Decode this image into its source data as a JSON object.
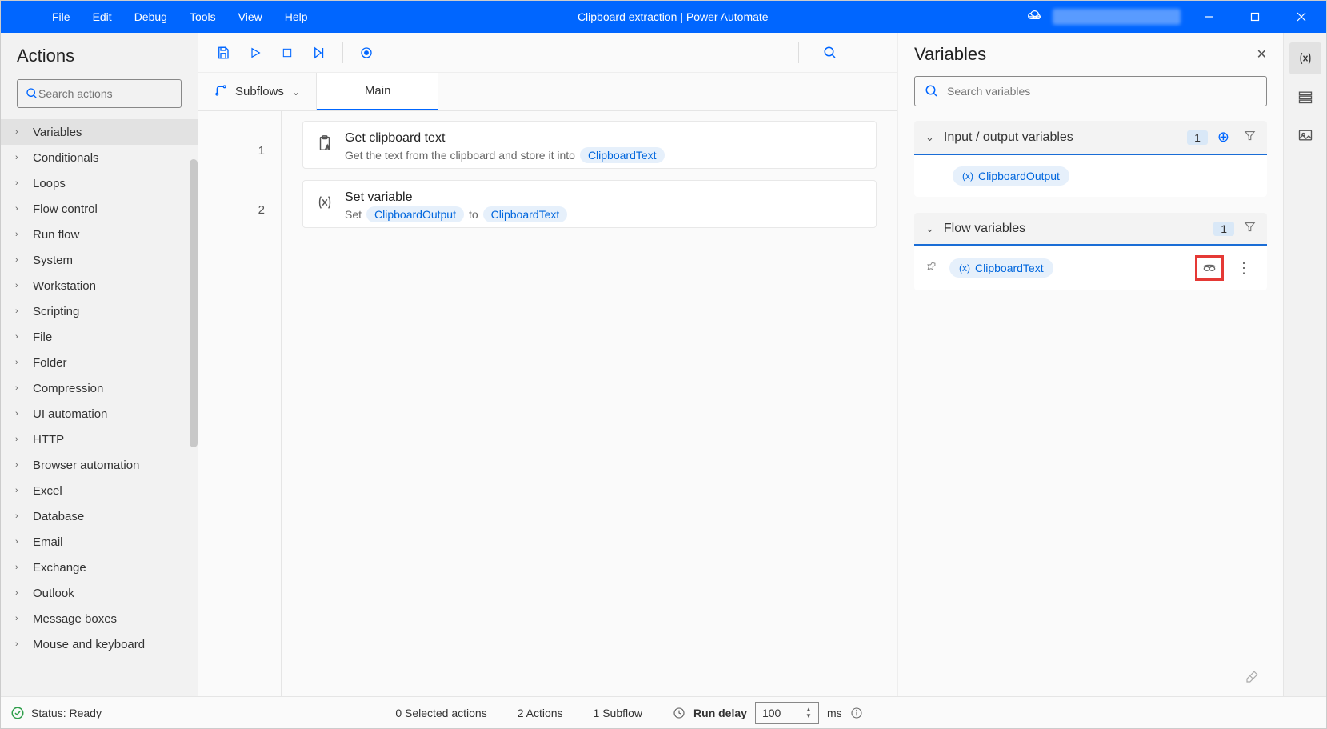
{
  "titlebar": {
    "menus": [
      "File",
      "Edit",
      "Debug",
      "Tools",
      "View",
      "Help"
    ],
    "title": "Clipboard extraction | Power Automate"
  },
  "actions": {
    "header": "Actions",
    "search_placeholder": "Search actions",
    "categories": [
      "Variables",
      "Conditionals",
      "Loops",
      "Flow control",
      "Run flow",
      "System",
      "Workstation",
      "Scripting",
      "File",
      "Folder",
      "Compression",
      "UI automation",
      "HTTP",
      "Browser automation",
      "Excel",
      "Database",
      "Email",
      "Exchange",
      "Outlook",
      "Message boxes",
      "Mouse and keyboard"
    ]
  },
  "workspace": {
    "subflows_label": "Subflows",
    "tab_main": "Main",
    "steps": [
      {
        "num": "1",
        "title": "Get clipboard text",
        "desc_pre": "Get the text from the clipboard and store it into",
        "var1": "ClipboardText"
      },
      {
        "num": "2",
        "title": "Set variable",
        "desc_pre": "Set",
        "var1": "ClipboardOutput",
        "mid": "to",
        "var2": "ClipboardText"
      }
    ]
  },
  "variables": {
    "header": "Variables",
    "search_placeholder": "Search variables",
    "io_section": {
      "title": "Input / output variables",
      "count": "1",
      "var": "ClipboardOutput"
    },
    "flow_section": {
      "title": "Flow variables",
      "count": "1",
      "var": "ClipboardText"
    }
  },
  "statusbar": {
    "status": "Status: Ready",
    "selected": "0 Selected actions",
    "actions": "2 Actions",
    "subflow": "1 Subflow",
    "delay_label": "Run delay",
    "delay_value": "100",
    "delay_unit": "ms"
  }
}
